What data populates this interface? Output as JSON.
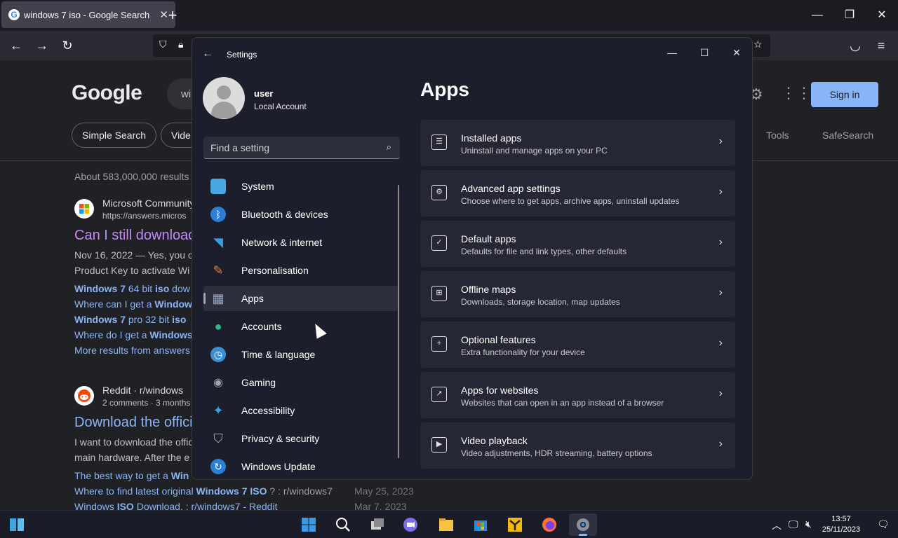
{
  "browser": {
    "tab_title": "windows 7 iso - Google Search",
    "tab_favicon": "G",
    "new_tab": "+",
    "minimize": "—",
    "restore": "❐",
    "close": "✕"
  },
  "google": {
    "logo": "Google",
    "query": "wi",
    "sign_in": "Sign in",
    "chips": [
      "Simple Search",
      "Vide"
    ],
    "tools": "Tools",
    "safesearch": "SafeSearch",
    "stats": "About 583,000,000 results",
    "results": [
      {
        "site": "Microsoft Community",
        "url": "https://answers.micros",
        "title": "Can I still download",
        "snippet1": "Nov 16, 2022 — Yes, you c",
        "snippet2": "Product Key to activate Wi",
        "links": [
          {
            "bold": "Windows 7",
            "mid": " 64 bit ",
            "bold2": "iso",
            "rest": " dow"
          },
          {
            "bold": "",
            "mid": "Where can I get a ",
            "bold2": "Window",
            "rest": ""
          },
          {
            "bold": "Windows 7",
            "mid": " pro 32 bit ",
            "bold2": "iso",
            "rest": ""
          },
          {
            "bold": "",
            "mid": "Where do I get a ",
            "bold2": "Windows",
            "rest": ""
          },
          {
            "bold": "",
            "mid": "More results from answers",
            "bold2": "",
            "rest": ""
          }
        ]
      },
      {
        "site": "Reddit · r/windows",
        "url": "2 comments · 3 months",
        "title": "Download the offici",
        "snippet1": "I want to download the offic",
        "snippet2": "main hardware. After the e",
        "links": [
          {
            "bold": "",
            "mid": "The best way to get a ",
            "bold2": "Win",
            "rest": "",
            "date": ""
          },
          {
            "bold": "",
            "mid": "Where to find latest original ",
            "bold2": "Windows 7 ISO",
            "rest": " ? : r/windows7",
            "date": "May 25, 2023"
          },
          {
            "bold": "",
            "mid": "Windows ",
            "bold2": "ISO",
            "rest": " Download. : r/windows7 - Reddit",
            "date": "Mar 7, 2023"
          }
        ]
      }
    ]
  },
  "settings": {
    "window_title": "Settings",
    "user_name": "user",
    "account_type": "Local Account",
    "search_placeholder": "Find a setting",
    "page_title": "Apps",
    "nav": [
      {
        "label": "System",
        "icon": "monitor-icon",
        "color": "#4aa8e0",
        "glyph": "▭"
      },
      {
        "label": "Bluetooth & devices",
        "icon": "bluetooth-icon",
        "color": "#2b7fd6",
        "glyph": "ᛒ"
      },
      {
        "label": "Network & internet",
        "icon": "wifi-icon",
        "color": "#3b9ce6",
        "glyph": "◠"
      },
      {
        "label": "Personalisation",
        "icon": "brush-icon",
        "color": "#d9804a",
        "glyph": "✎"
      },
      {
        "label": "Apps",
        "icon": "apps-icon",
        "color": "#7a8aa6",
        "glyph": "▦"
      },
      {
        "label": "Accounts",
        "icon": "person-icon",
        "color": "#2fb88a",
        "glyph": "●"
      },
      {
        "label": "Time & language",
        "icon": "globe-clock-icon",
        "color": "#3d8fd1",
        "glyph": "◷"
      },
      {
        "label": "Gaming",
        "icon": "gamepad-icon",
        "color": "#8a8f99",
        "glyph": "◉"
      },
      {
        "label": "Accessibility",
        "icon": "accessibility-icon",
        "color": "#3b9ce6",
        "glyph": "✦"
      },
      {
        "label": "Privacy & security",
        "icon": "shield-icon",
        "color": "#8a8f99",
        "glyph": "⛉"
      },
      {
        "label": "Windows Update",
        "icon": "update-icon",
        "color": "#2b7fd6",
        "glyph": "↻"
      }
    ],
    "cards": [
      {
        "title": "Installed apps",
        "desc": "Uninstall and manage apps on your PC",
        "icon": "list-icon",
        "glyph": "☰"
      },
      {
        "title": "Advanced app settings",
        "desc": "Choose where to get apps, archive apps, uninstall updates",
        "icon": "app-gear-icon",
        "glyph": "⚙"
      },
      {
        "title": "Default apps",
        "desc": "Defaults for file and link types, other defaults",
        "icon": "default-apps-icon",
        "glyph": "✓"
      },
      {
        "title": "Offline maps",
        "desc": "Downloads, storage location, map updates",
        "icon": "map-icon",
        "glyph": "⊞"
      },
      {
        "title": "Optional features",
        "desc": "Extra functionality for your device",
        "icon": "optional-features-icon",
        "glyph": "+"
      },
      {
        "title": "Apps for websites",
        "desc": "Websites that can open in an app instead of a browser",
        "icon": "open-external-icon",
        "glyph": "↗"
      },
      {
        "title": "Video playback",
        "desc": "Video adjustments, HDR streaming, battery options",
        "icon": "video-icon",
        "glyph": "▶"
      }
    ]
  },
  "taskbar": {
    "time": "13:57",
    "date": "25/11/2023"
  }
}
